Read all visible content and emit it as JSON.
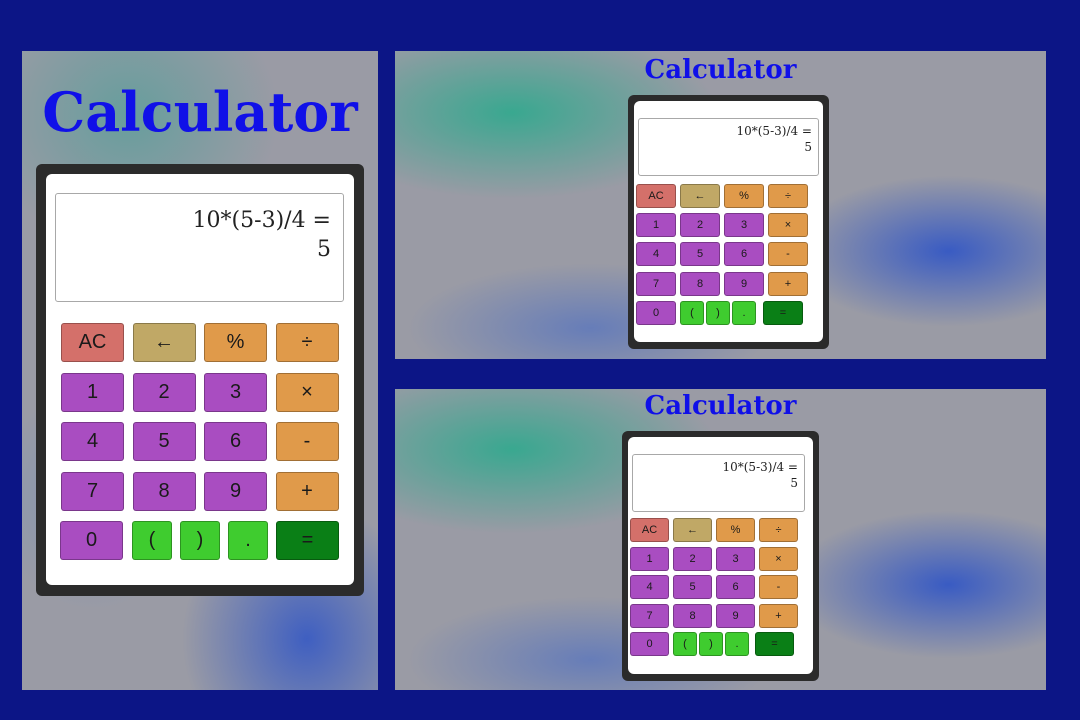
{
  "app": {
    "title": "Calculator"
  },
  "display": {
    "expression": "10*(5-3)/4 =",
    "result": "5"
  },
  "keypad": {
    "rows": [
      [
        {
          "label": "AC",
          "name": "clear-button",
          "kind": "clear"
        },
        {
          "label": "←",
          "name": "backspace-button",
          "kind": "back"
        },
        {
          "label": "%",
          "name": "percent-button",
          "kind": "op"
        },
        {
          "label": "÷",
          "name": "divide-button",
          "kind": "op"
        }
      ],
      [
        {
          "label": "1",
          "name": "digit-1-button",
          "kind": "num"
        },
        {
          "label": "2",
          "name": "digit-2-button",
          "kind": "num"
        },
        {
          "label": "3",
          "name": "digit-3-button",
          "kind": "num"
        },
        {
          "label": "×",
          "name": "multiply-button",
          "kind": "op"
        }
      ],
      [
        {
          "label": "4",
          "name": "digit-4-button",
          "kind": "num"
        },
        {
          "label": "5",
          "name": "digit-5-button",
          "kind": "num"
        },
        {
          "label": "6",
          "name": "digit-6-button",
          "kind": "num"
        },
        {
          "label": "-",
          "name": "subtract-button",
          "kind": "op"
        }
      ],
      [
        {
          "label": "7",
          "name": "digit-7-button",
          "kind": "num"
        },
        {
          "label": "8",
          "name": "digit-8-button",
          "kind": "num"
        },
        {
          "label": "9",
          "name": "digit-9-button",
          "kind": "num"
        },
        {
          "label": "+",
          "name": "add-button",
          "kind": "op"
        }
      ],
      [
        {
          "label": "0",
          "name": "digit-0-button",
          "kind": "num"
        },
        {
          "label": "(",
          "name": "open-paren-button",
          "kind": "paren"
        },
        {
          "label": ")",
          "name": "close-paren-button",
          "kind": "paren"
        },
        {
          "label": ".",
          "name": "decimal-button",
          "kind": "paren"
        },
        {
          "label": "=",
          "name": "equals-button",
          "kind": "eq"
        }
      ]
    ]
  },
  "colors": {
    "background": "#0c1586",
    "title": "#1010e8",
    "clear": "#d4706a",
    "back": "#c0a866",
    "op": "#e09a4a",
    "num": "#a94dc1",
    "paren": "#3fcc2f",
    "eq": "#0a7f16"
  }
}
